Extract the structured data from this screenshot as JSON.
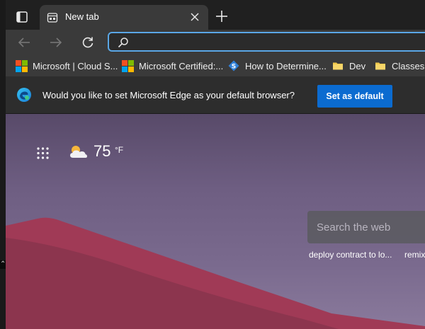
{
  "tab": {
    "title": "New tab"
  },
  "address_bar": {
    "value": "",
    "placeholder": ""
  },
  "favorites": [
    {
      "label": "Microsoft | Cloud S...",
      "icon": "microsoft-logo-icon"
    },
    {
      "label": "Microsoft Certified:...",
      "icon": "microsoft-logo-icon"
    },
    {
      "label": "How to Determine...",
      "icon": "blue-diamond-icon"
    },
    {
      "label": "Dev",
      "icon": "folder-icon"
    },
    {
      "label": "Classes",
      "icon": "folder-icon"
    }
  ],
  "infobar": {
    "message": "Would you like to set Microsoft Edge as your default browser?",
    "button_label": "Set as default"
  },
  "weather": {
    "temperature": "75",
    "unit": "°F",
    "icon": "partly-cloudy-icon"
  },
  "search": {
    "placeholder": "Search the web",
    "suggestions": [
      "deploy contract to lo...",
      "remix"
    ]
  },
  "colors": {
    "accent": "#0b6bd0",
    "focus_ring": "#5aa7e6",
    "folder": "#f2c84b"
  }
}
